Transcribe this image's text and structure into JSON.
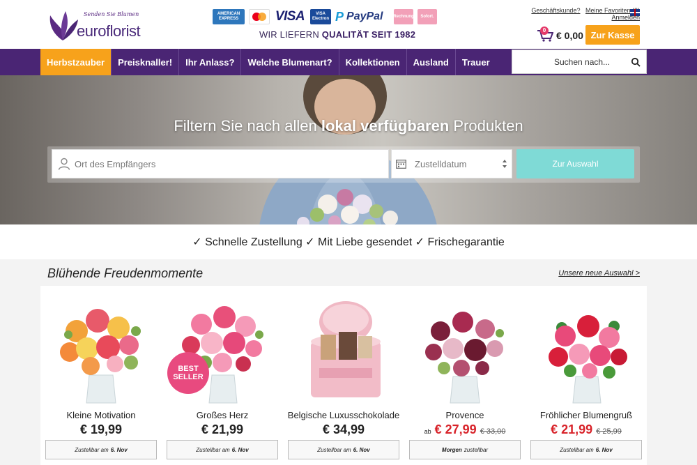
{
  "header": {
    "logo_tagline": "Senden Sie Blumen",
    "logo_word": "euroflorist",
    "tagline_prefix": "WIR LIEFERN ",
    "tagline_bold": "QUALITÄT SEIT 1982",
    "payments": {
      "amex": "AMERICAN EXPRESS",
      "mastercard": "mastercard",
      "visa": "VISA",
      "visa_electron": "VISA Electron",
      "paypal": "PayPal",
      "rechnung": "Rechnung",
      "sofort": "Sofort."
    },
    "business_link": "Geschäftskunde?",
    "favorites_link": "Meine Favoriten (0)",
    "login_link": "Anmelden",
    "cart_count": "0",
    "cart_total": "€ 0,00",
    "checkout_label": "Zur Kasse"
  },
  "nav": {
    "items": [
      {
        "label": "Herbstzauber"
      },
      {
        "label": "Preisknaller!"
      },
      {
        "label": "Ihr Anlass?"
      },
      {
        "label": "Welche Blumenart?"
      },
      {
        "label": "Kollektionen"
      },
      {
        "label": "Ausland"
      },
      {
        "label": "Trauer"
      }
    ],
    "search_placeholder": "Suchen nach..."
  },
  "hero": {
    "title_prefix": "Filtern Sie nach allen ",
    "title_bold": "lokal verfügbaren",
    "title_suffix": " Produkten",
    "location_placeholder": "Ort des Empfängers",
    "date_placeholder": "Zustelldatum",
    "filter_button": "Zur Auswahl"
  },
  "usp": {
    "text": "✓ Schnelle Zustellung ✓ Mit Liebe gesendet ✓ Frischegarantie"
  },
  "products": {
    "section_title": "Blühende Freudenmomente",
    "section_link": "Unsere neue Auswahl >",
    "items": [
      {
        "name": "Kleine Motivation",
        "price": "€ 19,99",
        "delivery_prefix": "Zustellbar am",
        "delivery_date": "6. Nov"
      },
      {
        "name": "Großes Herz",
        "price": "€ 21,99",
        "badge": "BEST SELLER",
        "delivery_prefix": "Zustellbar am",
        "delivery_date": "6. Nov"
      },
      {
        "name": "Belgische Luxusschokolade",
        "price": "€ 34,99",
        "delivery_prefix": "Zustellbar am",
        "delivery_date": "6. Nov"
      },
      {
        "name": "Provence",
        "price_prefix": "ab",
        "price": "€ 27,99",
        "old_price": "€ 33,00",
        "delivery_bold": "Morgen",
        "delivery_suffix": "zustellbar"
      },
      {
        "name": "Fröhlicher Blumengruß",
        "price": "€ 21,99",
        "old_price": "€ 25,99",
        "delivery_prefix": "Zustellbar am",
        "delivery_date": "6. Nov"
      }
    ]
  },
  "colors": {
    "brand_purple": "#4a2574",
    "accent_orange": "#f7a21b",
    "button_teal": "#7fdad6",
    "sale_red": "#d8232a",
    "badge_pink": "#e84a7f"
  },
  "icons": [
    "euroflorist-logo-icon",
    "flag-uk-icon",
    "cart-icon",
    "search-icon",
    "person-icon",
    "calendar-icon",
    "updown-icon"
  ]
}
